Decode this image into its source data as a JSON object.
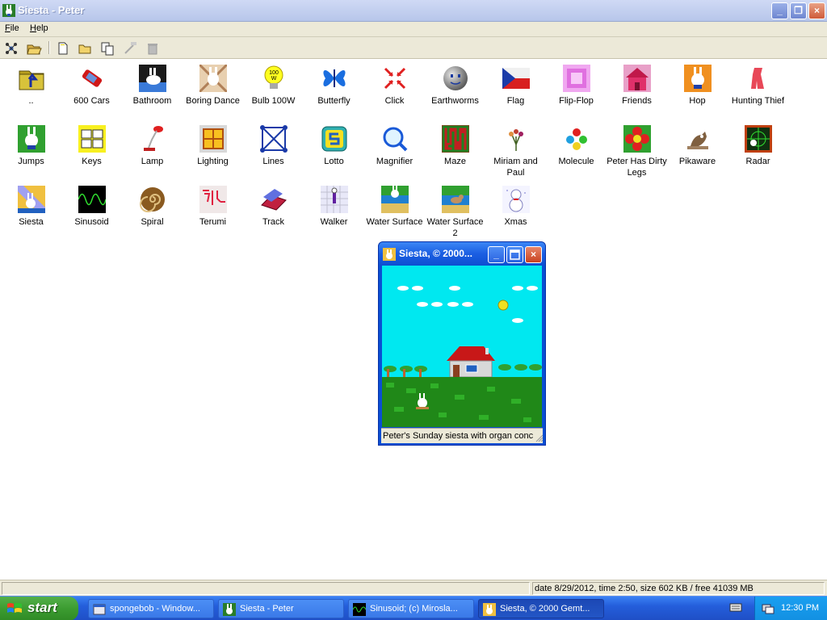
{
  "window": {
    "title": "Siesta - Peter",
    "controls": {
      "minimize": "_",
      "maximize": "❐",
      "close": "×"
    }
  },
  "menu": {
    "file": "File",
    "help": "Help"
  },
  "toolbar": {
    "icons": [
      "network-icon",
      "open-folder-icon",
      "new-document-icon",
      "folder-icon",
      "copy-icon",
      "text-icon",
      "trash-icon"
    ]
  },
  "icons": [
    {
      "label": "..",
      "icon": "folder-up-icon"
    },
    {
      "label": "600 Cars",
      "icon": "car-icon"
    },
    {
      "label": "Bathroom",
      "icon": "bathroom-icon"
    },
    {
      "label": "Boring Dance",
      "icon": "dance-icon"
    },
    {
      "label": "Bulb 100W",
      "icon": "bulb-icon"
    },
    {
      "label": "Butterfly",
      "icon": "butterfly-icon"
    },
    {
      "label": "Click",
      "icon": "click-icon"
    },
    {
      "label": "Earthworms",
      "icon": "ball-face-icon"
    },
    {
      "label": "Flag",
      "icon": "flag-icon"
    },
    {
      "label": "Flip-Flop",
      "icon": "flip-flop-icon"
    },
    {
      "label": "Friends",
      "icon": "house-icon"
    },
    {
      "label": "Hop",
      "icon": "bunny-icon"
    },
    {
      "label": "Hunting Thief",
      "icon": "thief-icon"
    },
    {
      "label": "Jumps",
      "icon": "bunny-jump-icon"
    },
    {
      "label": "Keys",
      "icon": "keys-icon"
    },
    {
      "label": "Lamp",
      "icon": "lamp-icon"
    },
    {
      "label": "Lighting",
      "icon": "window-icon"
    },
    {
      "label": "Lines",
      "icon": "lines-icon"
    },
    {
      "label": "Lotto",
      "icon": "lotto-icon"
    },
    {
      "label": "Magnifier",
      "icon": "magnifier-icon"
    },
    {
      "label": "Maze",
      "icon": "maze-icon"
    },
    {
      "label": "Miriam and Paul",
      "icon": "flowers-icon"
    },
    {
      "label": "Molecule",
      "icon": "molecule-icon"
    },
    {
      "label": "Peter Has Dirty Legs",
      "icon": "flower-icon"
    },
    {
      "label": "Pikaware",
      "icon": "pikaware-icon"
    },
    {
      "label": "Radar",
      "icon": "radar-icon"
    },
    {
      "label": "Siesta",
      "icon": "siesta-icon"
    },
    {
      "label": "Sinusoid",
      "icon": "sinusoid-icon"
    },
    {
      "label": "Spiral",
      "icon": "spiral-icon"
    },
    {
      "label": "Terumi",
      "icon": "terumi-icon"
    },
    {
      "label": "Track",
      "icon": "track-icon"
    },
    {
      "label": "Walker",
      "icon": "walker-icon"
    },
    {
      "label": "Water Surface",
      "icon": "water-icon"
    },
    {
      "label": "Water Surface 2",
      "icon": "water-duck-icon"
    },
    {
      "label": "Xmas",
      "icon": "snowman-icon"
    }
  ],
  "statusbar": {
    "left": "",
    "right": "date 8/29/2012, time 2:50, size 602 KB / free 41039 MB"
  },
  "child_window": {
    "title": "Siesta, © 2000...",
    "status": "Peter's Sunday siesta with organ conc"
  },
  "taskbar": {
    "start": "start",
    "tasks": [
      {
        "label": "spongebob - Window...",
        "icon": "explorer-icon",
        "active": false
      },
      {
        "label": "Siesta - Peter",
        "icon": "bunny-icon",
        "active": false
      },
      {
        "label": "Sinusoid;  (c) Mirosla...",
        "icon": "sinusoid-icon",
        "active": false
      },
      {
        "label": "Siesta, © 2000 Gemt...",
        "icon": "siesta-icon",
        "active": true
      }
    ],
    "clock": "12:30 PM"
  }
}
